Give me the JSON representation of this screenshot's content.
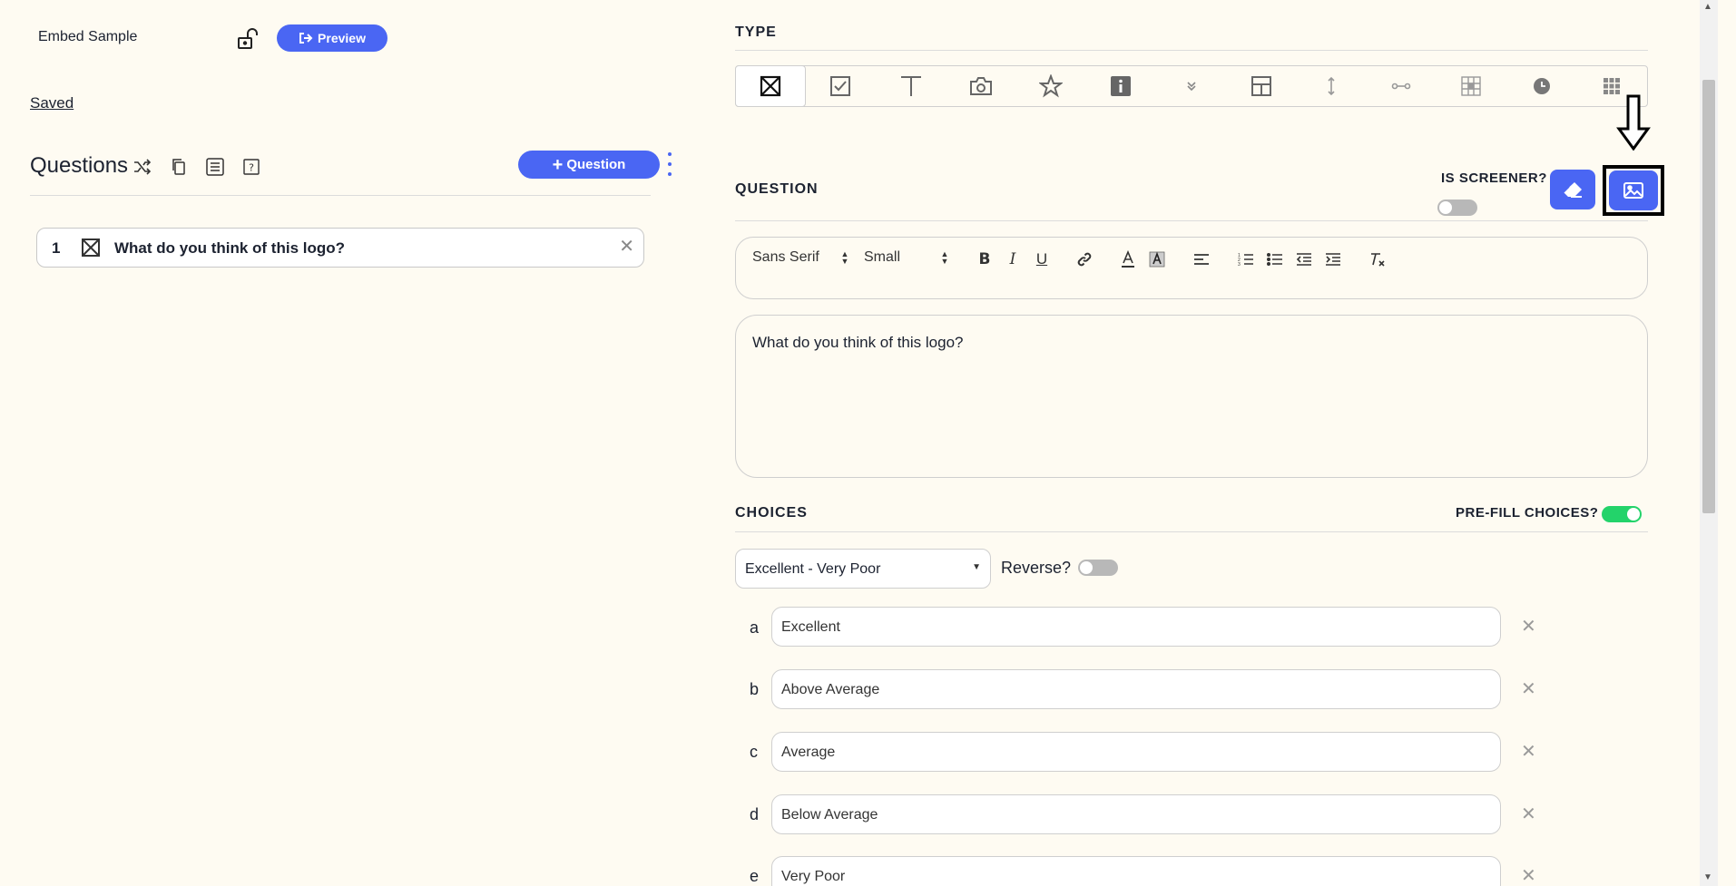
{
  "header": {
    "survey_title": "Embed Sample",
    "preview_label": "Preview",
    "saved_label": "Saved"
  },
  "questions_panel": {
    "title": "Questions",
    "add_question_label": "Question",
    "items": [
      {
        "number": "1",
        "text": "What do you think of this logo?"
      }
    ]
  },
  "editor": {
    "type_label": "TYPE",
    "question_label": "QUESTION",
    "is_screener_label": "IS SCREENER?",
    "toolbar": {
      "font": "Sans Serif",
      "size": "Small"
    },
    "question_text": "What do you think of this logo?",
    "choices_label": "CHOICES",
    "prefill_label": "PRE-FILL CHOICES?",
    "scale_value": "Excellent - Very Poor",
    "reverse_label": "Reverse?",
    "choices": [
      {
        "letter": "a",
        "value": "Excellent"
      },
      {
        "letter": "b",
        "value": "Above Average"
      },
      {
        "letter": "c",
        "value": "Average"
      },
      {
        "letter": "d",
        "value": "Below Average"
      },
      {
        "letter": "e",
        "value": "Very Poor"
      }
    ]
  },
  "colors": {
    "accent": "#4a66f3",
    "toggle_on": "#23d36a",
    "background": "#fefbf2"
  }
}
